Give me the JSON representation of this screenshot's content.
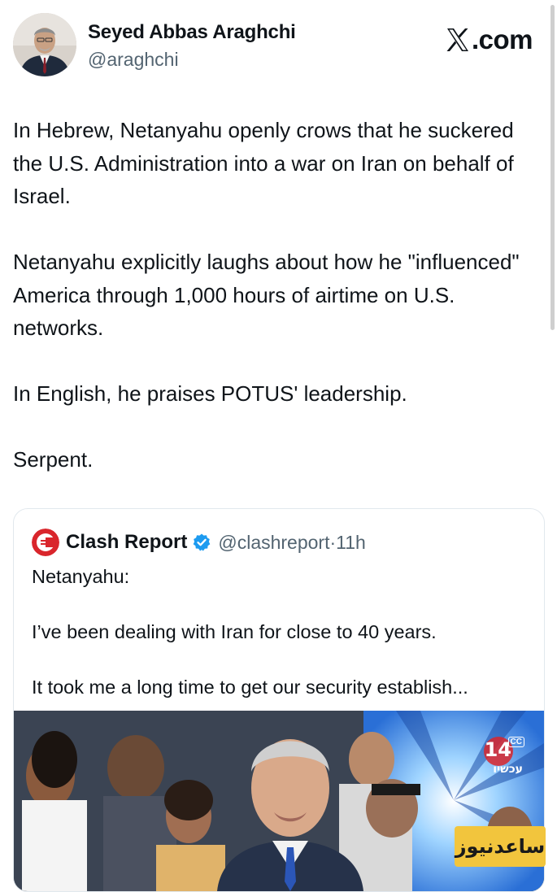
{
  "author": {
    "name": "Seyed Abbas Araghchi",
    "handle": "@araghchi"
  },
  "site": {
    "label": ".com"
  },
  "tweet": {
    "paragraphs": [
      "In Hebrew, Netanyahu openly crows that he suckered the U.S. Administration into a war on Iran on behalf of Israel.",
      "Netanyahu explicitly laughs about how he \"influenced\" America through 1,000 hours of airtime on U.S. networks.",
      "In English, he praises POTUS' leadership.",
      "Serpent."
    ]
  },
  "quote": {
    "name": "Clash Report",
    "handle": "@clashreport",
    "separator": "·",
    "time": "11h",
    "paragraphs": [
      "Netanyahu:",
      "I’ve been dealing with Iran for close to 40 years.",
      "It took me a long time to get our security establish..."
    ],
    "media": {
      "channel_number": "14",
      "channel_cc": "CC",
      "channel_name": "עכשיו"
    }
  },
  "watermark": {
    "text": "ساعدنیوز"
  },
  "colors": {
    "text": "#0f1419",
    "secondary": "#536471",
    "verified": "#1d9bf0",
    "border": "#e1e8ed",
    "clash_red": "#d9262c",
    "watermark_bg": "#f2c53d"
  }
}
